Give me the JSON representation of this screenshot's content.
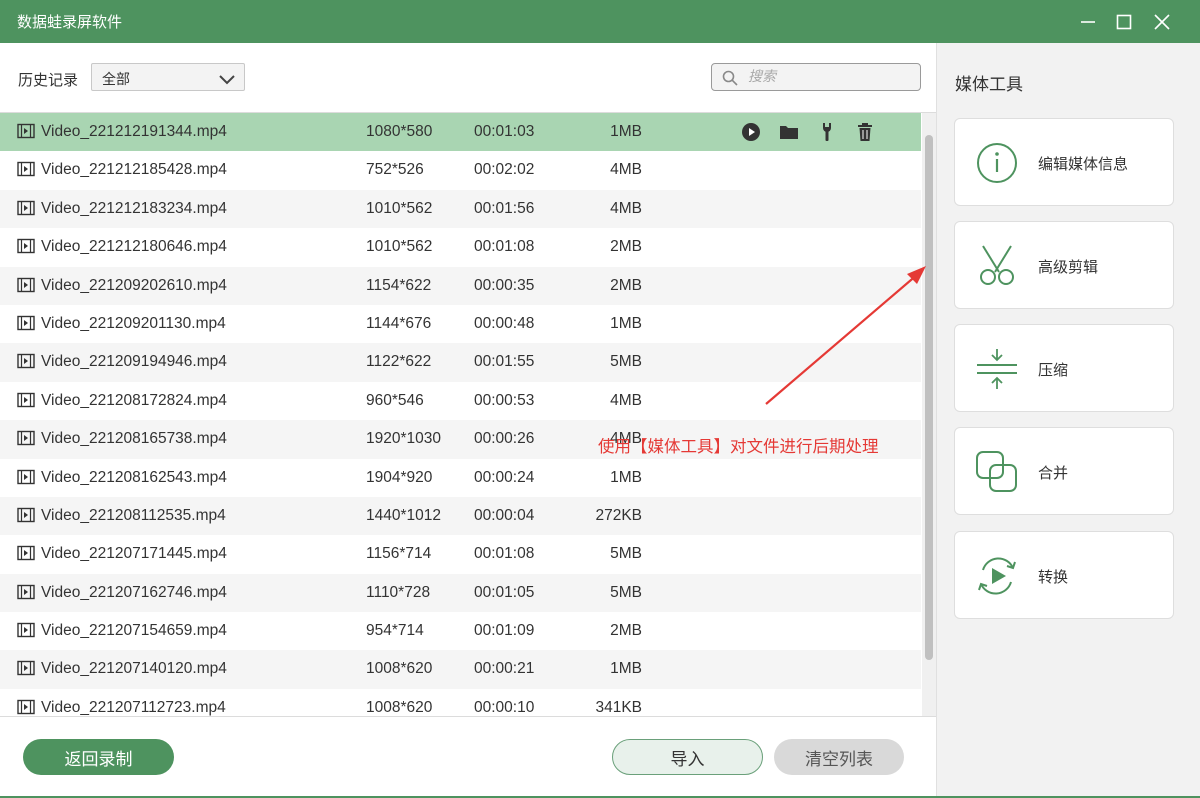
{
  "window": {
    "title": "数据蛙录屏软件"
  },
  "toolbar": {
    "history_label": "历史记录",
    "filter_value": "全部",
    "search_placeholder": "搜索"
  },
  "files": [
    {
      "name": "Video_221212191344.mp4",
      "resolution": "1080*580",
      "duration": "00:01:03",
      "size": "1MB"
    },
    {
      "name": "Video_221212185428.mp4",
      "resolution": "752*526",
      "duration": "00:02:02",
      "size": "4MB"
    },
    {
      "name": "Video_221212183234.mp4",
      "resolution": "1010*562",
      "duration": "00:01:56",
      "size": "4MB"
    },
    {
      "name": "Video_221212180646.mp4",
      "resolution": "1010*562",
      "duration": "00:01:08",
      "size": "2MB"
    },
    {
      "name": "Video_221209202610.mp4",
      "resolution": "1154*622",
      "duration": "00:00:35",
      "size": "2MB"
    },
    {
      "name": "Video_221209201130.mp4",
      "resolution": "1144*676",
      "duration": "00:00:48",
      "size": "1MB"
    },
    {
      "name": "Video_221209194946.mp4",
      "resolution": "1122*622",
      "duration": "00:01:55",
      "size": "5MB"
    },
    {
      "name": "Video_221208172824.mp4",
      "resolution": "960*546",
      "duration": "00:00:53",
      "size": "4MB"
    },
    {
      "name": "Video_221208165738.mp4",
      "resolution": "1920*1030",
      "duration": "00:00:26",
      "size": "4MB"
    },
    {
      "name": "Video_221208162543.mp4",
      "resolution": "1904*920",
      "duration": "00:00:24",
      "size": "1MB"
    },
    {
      "name": "Video_221208112535.mp4",
      "resolution": "1440*1012",
      "duration": "00:00:04",
      "size": "272KB"
    },
    {
      "name": "Video_221207171445.mp4",
      "resolution": "1156*714",
      "duration": "00:01:08",
      "size": "5MB"
    },
    {
      "name": "Video_221207162746.mp4",
      "resolution": "1110*728",
      "duration": "00:01:05",
      "size": "5MB"
    },
    {
      "name": "Video_221207154659.mp4",
      "resolution": "954*714",
      "duration": "00:01:09",
      "size": "2MB"
    },
    {
      "name": "Video_221207140120.mp4",
      "resolution": "1008*620",
      "duration": "00:00:21",
      "size": "1MB"
    },
    {
      "name": "Video_221207112723.mp4",
      "resolution": "1008*620",
      "duration": "00:00:10",
      "size": "341KB"
    }
  ],
  "row_actions": [
    "play-icon",
    "folder-icon",
    "wrench-icon",
    "trash-icon"
  ],
  "buttons": {
    "back": "返回录制",
    "import": "导入",
    "clear": "清空列表"
  },
  "media_tools": {
    "title": "媒体工具",
    "items": [
      {
        "label": "编辑媒体信息",
        "icon": "info-icon"
      },
      {
        "label": "高级剪辑",
        "icon": "scissors-icon"
      },
      {
        "label": "压缩",
        "icon": "compress-icon"
      },
      {
        "label": "合并",
        "icon": "merge-icon"
      },
      {
        "label": "转换",
        "icon": "convert-icon"
      }
    ]
  },
  "annotation": {
    "text": "使用【媒体工具】对文件进行后期处理"
  },
  "colors": {
    "brand_green": "#4e935f",
    "selected_row": "#a9d5b2",
    "annotation_red": "#e53935"
  }
}
